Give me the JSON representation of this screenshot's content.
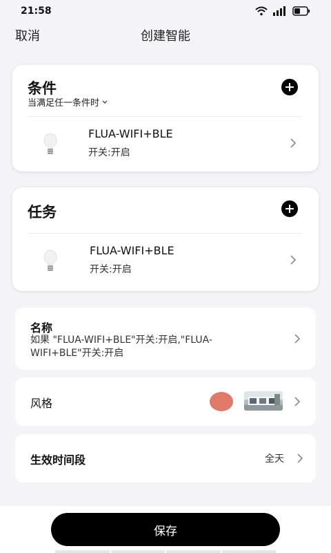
{
  "status_bar": {
    "time": "21:58"
  },
  "nav": {
    "cancel_label": "取消",
    "title": "创建智能"
  },
  "condition": {
    "title": "条件",
    "match_label": "当满足任一条件时",
    "device": {
      "name": "FLUA-WIFI+BLE",
      "state": "开关:开启"
    }
  },
  "task": {
    "title": "任务",
    "device": {
      "name": "FLUA-WIFI+BLE",
      "state": "开关:开启"
    }
  },
  "name_row": {
    "label": "名称",
    "value": "如果 \"FLUA-WIFI+BLE\"开关:开启,\"FLUA-WIFI+BLE\"开关:开启"
  },
  "style_row": {
    "label": "风格",
    "color": "#e07a68"
  },
  "time_row": {
    "label": "生效时间段",
    "value": "全天"
  },
  "save_label": "保存"
}
